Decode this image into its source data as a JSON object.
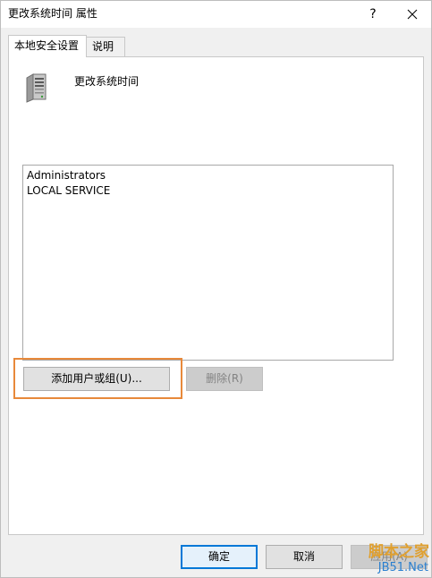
{
  "window": {
    "title": "更改系统时间 属性",
    "help_label": "?"
  },
  "tabs": [
    {
      "label": "本地安全设置"
    },
    {
      "label": "说明"
    }
  ],
  "policy": {
    "name": "更改系统时间",
    "icon": "server-icon"
  },
  "accounts": [
    "Administrators",
    "LOCAL SERVICE"
  ],
  "buttons": {
    "add": "添加用户或组(U)...",
    "remove": "删除(R)",
    "ok": "确定",
    "cancel": "取消",
    "apply": "应用(A)"
  },
  "watermark": {
    "line1": "脚本之家",
    "line2": "JB51.Net"
  },
  "colors": {
    "highlight": "#e8893a",
    "focus": "#0078d7"
  }
}
